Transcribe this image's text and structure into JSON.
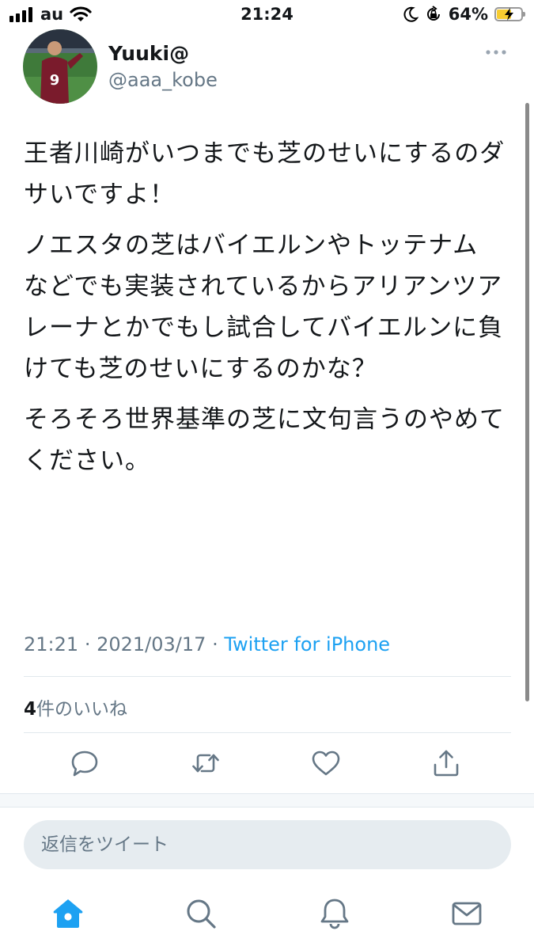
{
  "status_bar": {
    "carrier": "au",
    "time": "21:24",
    "battery_percent": "64%",
    "battery_level": 0.64,
    "icons": [
      "signal-icon",
      "wifi-icon",
      "moon-icon",
      "orientation-lock-icon",
      "battery-icon"
    ]
  },
  "tweet": {
    "author": {
      "display_name": "Yuuki@",
      "handle": "@aaa_kobe"
    },
    "paragraphs": [
      "王者川崎がいつまでも芝のせいにするのダサいですよ！",
      "ノエスタの芝はバイエルンやトッテナム\nなどでも実装されているからアリアンツアレーナとかでもし試合してバイエルンに負けても芝のせいにするのかな？",
      "そろそろ世界基準の芝に文句言うのやめてください。"
    ],
    "time": "21:21",
    "date": "2021/03/17",
    "separator": "·",
    "source": "Twitter for iPhone",
    "likes_count": "4",
    "likes_label": "件のいいね"
  },
  "actions": [
    "reply-icon",
    "retweet-icon",
    "like-icon",
    "share-icon"
  ],
  "reply": {
    "placeholder": "返信をツイート"
  },
  "bottom_nav": [
    "home-icon",
    "search-icon",
    "notifications-icon",
    "messages-icon"
  ],
  "colors": {
    "accent": "#1da1f2",
    "secondary_text": "#657786",
    "divider": "#e1e8ed",
    "battery": "#f7cc30"
  }
}
